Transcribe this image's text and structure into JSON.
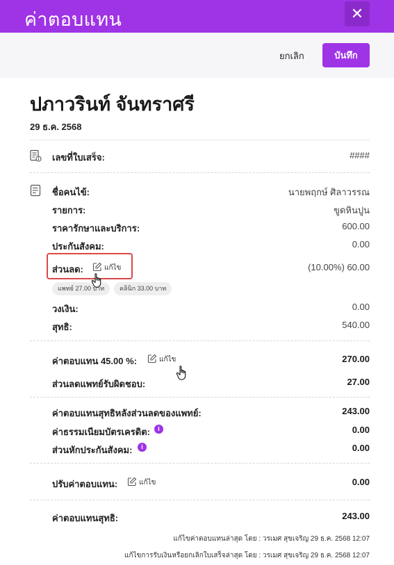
{
  "header": {
    "title": "ค่าตอบแทน",
    "close_label": "✕"
  },
  "actions": {
    "cancel_label": "ยกเลิก",
    "save_label": "บันทึก"
  },
  "patient": {
    "name": "ปภาวรินท์ จันทราศรี",
    "date": "29 ธ.ค. 2568"
  },
  "receipt": {
    "label": "เลขที่ใบเสร็จ:",
    "value": "####"
  },
  "details": {
    "patient_name_label": "ชื่อคนไข้:",
    "patient_name_value": "นายพฤกษ์ ศิลาวรรณ",
    "item_label": "รายการ:",
    "item_value": "ขูดหินปูน",
    "cost_label": "ราคารักษาและบริการ:",
    "cost_value": "600.00",
    "social_security_label": "ประกันสังคม:",
    "social_security_value": "0.00",
    "discount_label": "ส่วนลด:",
    "discount_edit": "แก้ไข",
    "discount_value": "(10.00%) 60.00",
    "chip_doctor": "แพทย์ 27.00 บาท",
    "chip_clinic": "คลินิก 33.00 บาท",
    "credit_limit_label": "วงเงิน:",
    "credit_limit_value": "0.00",
    "net_label": "สุทธิ:",
    "net_value": "540.00"
  },
  "compensation": {
    "rate_label": "ค่าตอบแทน 45.00 %:",
    "rate_edit": "แก้ไข",
    "rate_value": "270.00",
    "doctor_discount_label": "ส่วนลดแพทย์รับผิดชอบ:",
    "doctor_discount_value": "27.00"
  },
  "deductions": {
    "net_after_label": "ค่าตอบแทนสุทธิหลังส่วนลดของแพทย์:",
    "net_after_value": "243.00",
    "card_fee_label": "ค่าธรรมเนียมบัตรเครดิต:",
    "card_fee_value": "0.00",
    "ss_deduct_label": "ส่วนหักประกันสังคม:",
    "ss_deduct_value": "0.00"
  },
  "adjust": {
    "label": "ปรับค่าตอบแทน:",
    "edit": "แก้ไข",
    "value": "0.00"
  },
  "total": {
    "label": "ค่าตอบแทนสุทธิ:",
    "value": "243.00"
  },
  "footer": {
    "last_edit": "แก้ไขค่าตอบแทนล่าสุด โดย : วรเมศ สุขเจริญ 29 ธ.ค. 2568 12:07",
    "last_receipt": "แก้ไขการรับเงินหรือยกเลิกใบเสร็จล่าสุด โดย : วรเมศ สุขเจริญ 29 ธ.ค. 2568 12:07"
  },
  "colors": {
    "accent": "#9f33e6",
    "highlight": "#d94848"
  },
  "icons": [
    "close-icon",
    "receipt-icon",
    "document-icon",
    "edit-icon",
    "info-icon",
    "hand-cursor-icon"
  ]
}
